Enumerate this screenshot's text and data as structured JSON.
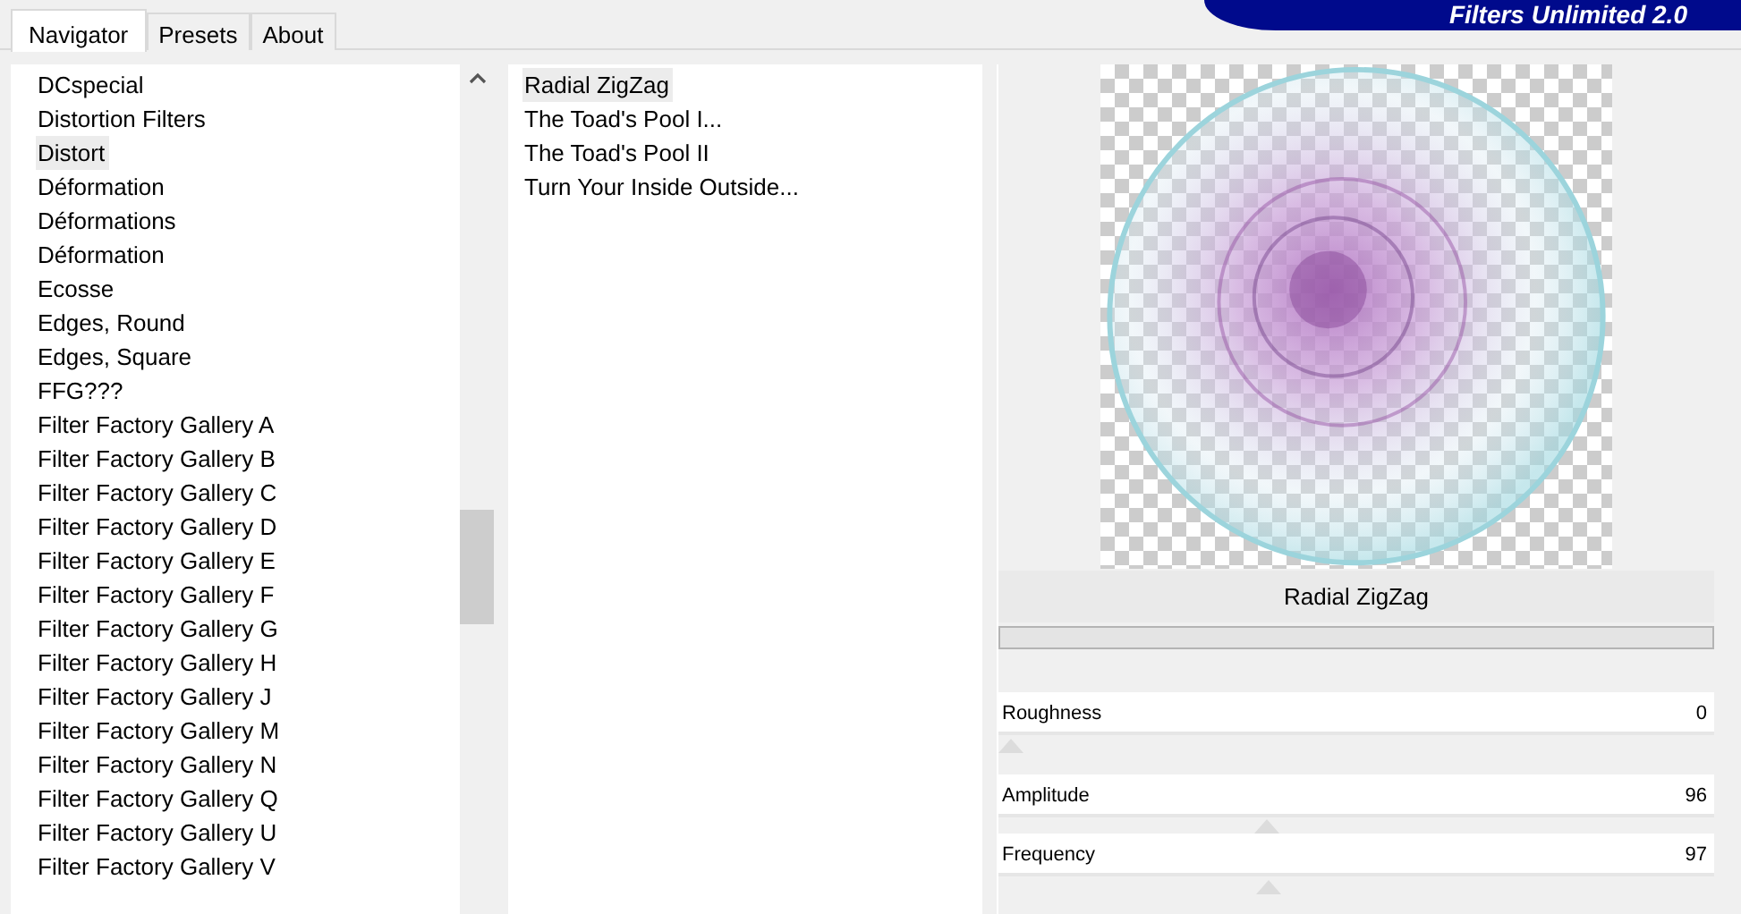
{
  "logo": {
    "text": "Filters Unlimited 2.0"
  },
  "tabs": [
    {
      "label": "Navigator",
      "selected": true
    },
    {
      "label": "Presets",
      "selected": false
    },
    {
      "label": "About",
      "selected": false
    }
  ],
  "categories": [
    {
      "label": "DCspecial",
      "selected": false
    },
    {
      "label": "Distortion Filters",
      "selected": false
    },
    {
      "label": "Distort",
      "selected": true
    },
    {
      "label": "Déformation",
      "selected": false
    },
    {
      "label": "Déformations",
      "selected": false
    },
    {
      "label": "Déformation",
      "selected": false
    },
    {
      "label": "Ecosse",
      "selected": false
    },
    {
      "label": "Edges, Round",
      "selected": false
    },
    {
      "label": "Edges, Square",
      "selected": false
    },
    {
      "label": "FFG???",
      "selected": false
    },
    {
      "label": "Filter Factory Gallery A",
      "selected": false
    },
    {
      "label": "Filter Factory Gallery B",
      "selected": false
    },
    {
      "label": "Filter Factory Gallery C",
      "selected": false
    },
    {
      "label": "Filter Factory Gallery D",
      "selected": false
    },
    {
      "label": "Filter Factory Gallery E",
      "selected": false
    },
    {
      "label": "Filter Factory Gallery F",
      "selected": false
    },
    {
      "label": "Filter Factory Gallery G",
      "selected": false
    },
    {
      "label": "Filter Factory Gallery H",
      "selected": false
    },
    {
      "label": "Filter Factory Gallery J",
      "selected": false
    },
    {
      "label": "Filter Factory Gallery M",
      "selected": false
    },
    {
      "label": "Filter Factory Gallery N",
      "selected": false
    },
    {
      "label": "Filter Factory Gallery Q",
      "selected": false
    },
    {
      "label": "Filter Factory Gallery U",
      "selected": false
    },
    {
      "label": "Filter Factory Gallery V",
      "selected": false
    }
  ],
  "filters": [
    {
      "label": "Radial ZigZag",
      "selected": true
    },
    {
      "label": "The Toad's Pool I...",
      "selected": false
    },
    {
      "label": "The Toad's Pool II",
      "selected": false
    },
    {
      "label": "Turn Your Inside Outside...",
      "selected": false
    }
  ],
  "filter_title": "Radial ZigZag",
  "progress": {
    "level": 0
  },
  "sliders": [
    {
      "label": "Roughness",
      "value": "0",
      "level": 0
    },
    {
      "label": "Amplitude",
      "value": "96",
      "level": 0.376
    },
    {
      "label": "Frequency",
      "value": "97",
      "level": 0.38
    }
  ]
}
